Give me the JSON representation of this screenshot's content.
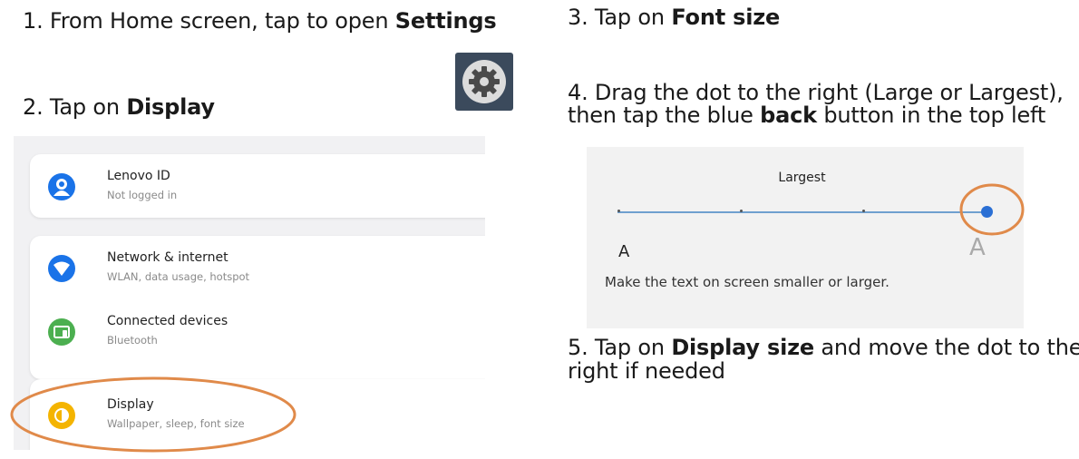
{
  "steps": {
    "s1": {
      "text": "1. From Home screen, tap to open ",
      "bold": "Settings"
    },
    "s2": {
      "text": "2. Tap on ",
      "bold": "Display"
    },
    "s3": {
      "text": "3. Tap on ",
      "bold": "Font size"
    },
    "s4": {
      "line1": "4. Drag the dot to the right (Large or Largest),",
      "line2_pre": "then tap the blue ",
      "line2_bold": "back",
      "line2_post": " button in the top left"
    },
    "s5": {
      "line1_pre": "5. Tap on ",
      "line1_bold": "Display size",
      "line1_post": " and move the dot to the",
      "line2": "right if needed"
    }
  },
  "settings_app_icon": "gear-icon",
  "settings_list": {
    "items": [
      {
        "title": "Lenovo ID",
        "subtitle": "Not logged in",
        "icon": "account-icon",
        "color": "#1a73e8"
      },
      {
        "title": "Network & internet",
        "subtitle": "WLAN, data usage, hotspot",
        "icon": "wifi-icon",
        "color": "#1a73e8"
      },
      {
        "title": "Connected devices",
        "subtitle": "Bluetooth",
        "icon": "devices-icon",
        "color": "#4caf50"
      },
      {
        "title": "Display",
        "subtitle": "Wallpaper, sleep, font size",
        "icon": "display-icon",
        "color": "#f4b400"
      }
    ]
  },
  "font_size": {
    "title": "Largest",
    "small_label": "A",
    "large_label": "A",
    "description": "Make the text on screen smaller or larger.",
    "level": 4,
    "levels": 4
  },
  "colors": {
    "highlight": "#e08a4a",
    "accent": "#2a6fd4"
  }
}
